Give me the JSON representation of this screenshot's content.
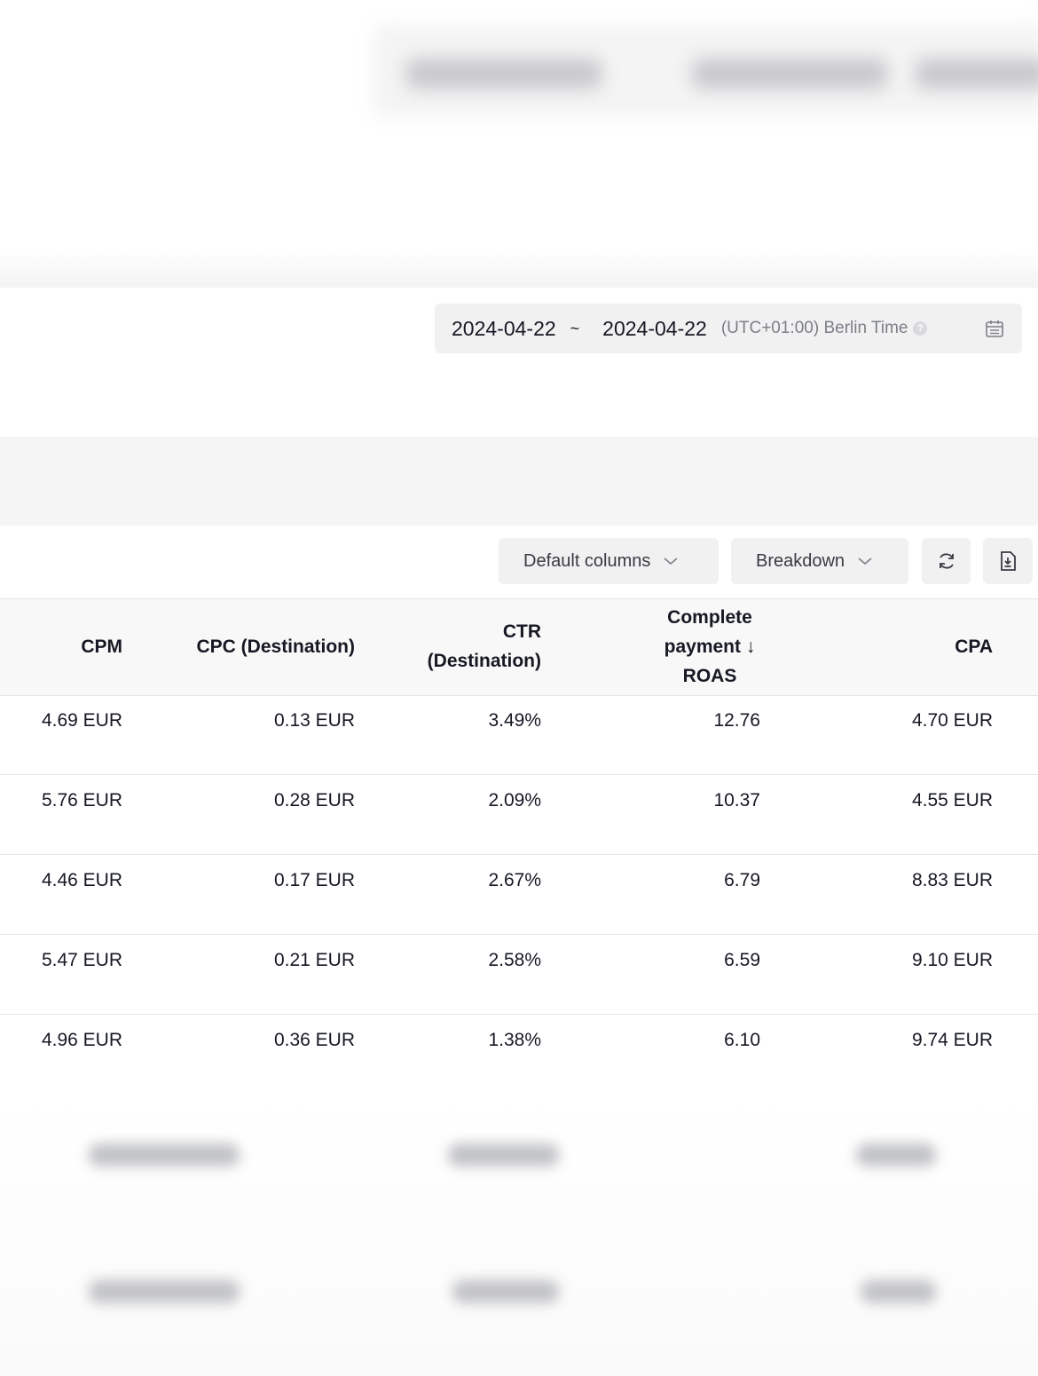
{
  "date_range": {
    "start": "2024-04-22",
    "separator": "~",
    "end": "2024-04-22",
    "timezone": "(UTC+01:00) Berlin Time"
  },
  "toolbar": {
    "default_columns": "Default columns",
    "breakdown": "Breakdown"
  },
  "table": {
    "headers": {
      "cpm": "CPM",
      "cpc": "CPC (Destination)",
      "ctr": "CTR\n(Destination)",
      "roas": "Complete\npayment ↓\nROAS",
      "cpa": "CPA"
    },
    "rows": [
      {
        "cpm": "4.69 EUR",
        "cpc": "0.13 EUR",
        "ctr": "3.49%",
        "roas": "12.76",
        "cpa": "4.70 EUR"
      },
      {
        "cpm": "5.76 EUR",
        "cpc": "0.28 EUR",
        "ctr": "2.09%",
        "roas": "10.37",
        "cpa": "4.55 EUR"
      },
      {
        "cpm": "4.46 EUR",
        "cpc": "0.17 EUR",
        "ctr": "2.67%",
        "roas": "6.79",
        "cpa": "8.83 EUR"
      },
      {
        "cpm": "5.47 EUR",
        "cpc": "0.21 EUR",
        "ctr": "2.58%",
        "roas": "6.59",
        "cpa": "9.10 EUR"
      },
      {
        "cpm": "4.96 EUR",
        "cpc": "0.36 EUR",
        "ctr": "1.38%",
        "roas": "6.10",
        "cpa": "9.74 EUR"
      }
    ]
  },
  "icons": {
    "help": "help-circle-icon",
    "calendar": "calendar-icon",
    "chevron": "chevron-down-icon",
    "refresh": "refresh-icon",
    "export": "export-file-icon"
  }
}
